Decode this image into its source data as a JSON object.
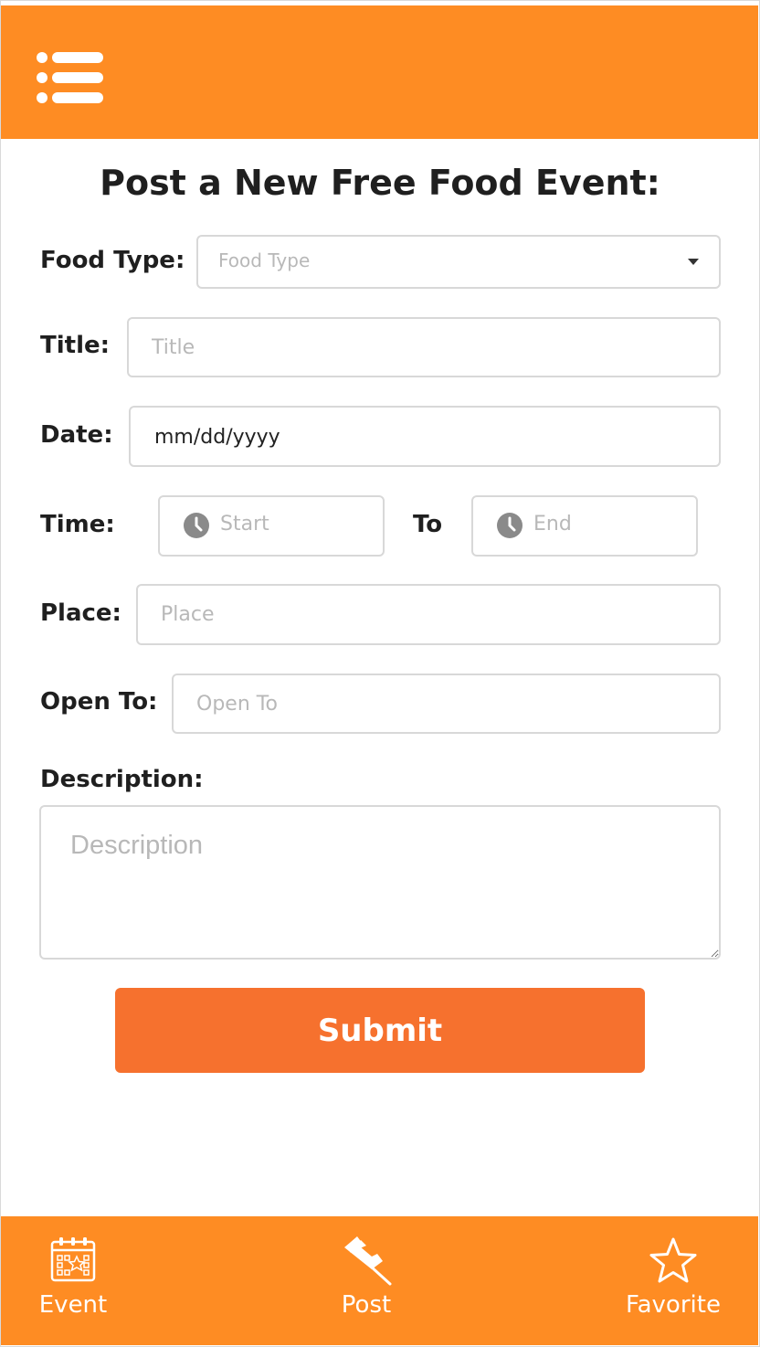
{
  "header": {
    "menu_icon": "hamburger-list-icon"
  },
  "page_title": "Post a New Free Food Event:",
  "form": {
    "food_type": {
      "label": "Food Type:",
      "selected": "Food Type"
    },
    "title": {
      "label": "Title:",
      "placeholder": "Title"
    },
    "date": {
      "label": "Date:",
      "value": "mm/dd/yyyy"
    },
    "time": {
      "label": "Time:",
      "start_placeholder": "Start",
      "separator": "To",
      "end_placeholder": "End"
    },
    "place": {
      "label": "Place:",
      "placeholder": "Place"
    },
    "open_to": {
      "label": "Open To:",
      "placeholder": "Open To"
    },
    "description": {
      "label": "Description:",
      "placeholder": "Description"
    },
    "submit_label": "Submit"
  },
  "bottom_nav": {
    "items": [
      {
        "label": "Event",
        "icon": "calendar-icon"
      },
      {
        "label": "Post",
        "icon": "pushpin-icon"
      },
      {
        "label": "Favorite",
        "icon": "star-icon"
      }
    ]
  },
  "colors": {
    "bar": "#fe8c23",
    "submit": "#f6712e",
    "placeholder": "#b8b8b8",
    "border": "#d8d8d8"
  }
}
